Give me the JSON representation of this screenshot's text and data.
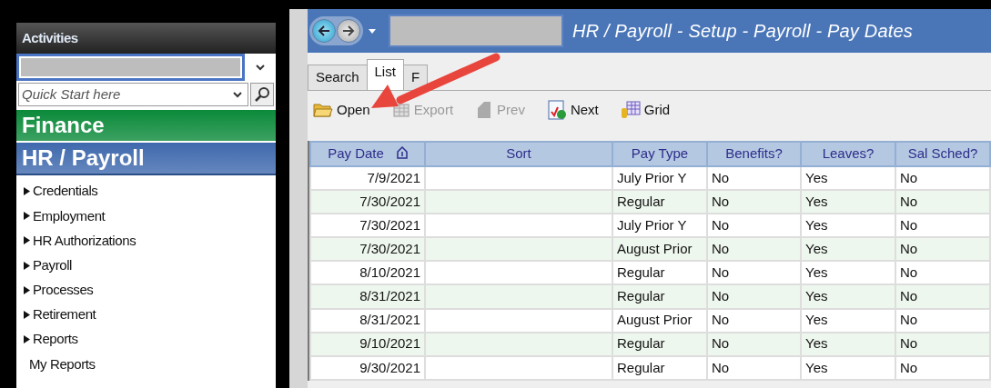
{
  "sidebar": {
    "title": "Activities",
    "quick_start": {
      "placeholder": "Quick Start here"
    },
    "modules": [
      {
        "label": "Finance",
        "color": "#0b8a3a",
        "expanded": false
      },
      {
        "label": "HR / Payroll",
        "color": "#3f69ad",
        "expanded": true
      }
    ],
    "items": [
      {
        "label": "Credentials",
        "expandable": true
      },
      {
        "label": "Employment",
        "expandable": true
      },
      {
        "label": "HR Authorizations",
        "expandable": true
      },
      {
        "label": "Payroll",
        "expandable": true
      },
      {
        "label": "Processes",
        "expandable": true
      },
      {
        "label": "Retirement",
        "expandable": true
      },
      {
        "label": "Reports",
        "expandable": true
      },
      {
        "label": "My Reports",
        "expandable": false
      }
    ]
  },
  "window": {
    "title": "HR / Payroll - Setup - Payroll - Pay Dates"
  },
  "tabs": [
    {
      "label": "Search",
      "selected": false
    },
    {
      "label": "List",
      "selected": true
    },
    {
      "label": "F",
      "selected": false
    }
  ],
  "toolbar": [
    {
      "kind": "open",
      "label": "Open",
      "disabled": false
    },
    {
      "kind": "export",
      "label": "Export",
      "disabled": true
    },
    {
      "kind": "prev",
      "label": "Prev",
      "disabled": true
    },
    {
      "kind": "next",
      "label": "Next",
      "disabled": false
    },
    {
      "kind": "grid",
      "label": "Grid",
      "disabled": false
    }
  ],
  "table": {
    "columns": [
      {
        "label": "Pay Date",
        "sorted": true
      },
      {
        "label": "Sort",
        "sorted": false
      },
      {
        "label": "Pay Type",
        "sorted": false
      },
      {
        "label": "Benefits?",
        "sorted": false
      },
      {
        "label": "Leaves?",
        "sorted": false
      },
      {
        "label": "Sal Sched?",
        "sorted": false
      }
    ],
    "rows": [
      [
        "7/9/2021",
        null,
        "July Prior Y",
        "No",
        "Yes",
        "No"
      ],
      [
        "7/30/2021",
        null,
        "Regular",
        "No",
        "Yes",
        "No"
      ],
      [
        "7/30/2021",
        null,
        "July Prior Y",
        "No",
        "Yes",
        "No"
      ],
      [
        "7/30/2021",
        null,
        "August Prior",
        "No",
        "Yes",
        "No"
      ],
      [
        "8/10/2021",
        null,
        "Regular",
        "No",
        "Yes",
        "No"
      ],
      [
        "8/31/2021",
        null,
        "Regular",
        "No",
        "Yes",
        "No"
      ],
      [
        "8/31/2021",
        null,
        "August Prior",
        "No",
        "Yes",
        "No"
      ],
      [
        "9/10/2021",
        null,
        "Regular",
        "No",
        "Yes",
        "No"
      ],
      [
        "9/30/2021",
        null,
        "Regular",
        "No",
        "Yes",
        "No"
      ]
    ]
  }
}
